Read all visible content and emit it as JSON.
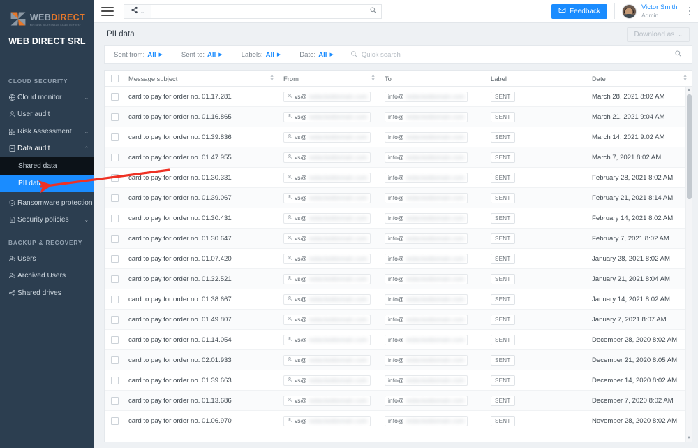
{
  "brand": {
    "logo_word_1": "WEB",
    "logo_word_2": "DIRECT",
    "logo_tagline": "BUSINESS RELATIONSHIP BASED ON TRUST",
    "company": "WEB DIRECT SRL"
  },
  "sidebar": {
    "section_cloud": "CLOUD SECURITY",
    "section_backup": "BACKUP & RECOVERY",
    "cloud_items": [
      {
        "label": "Cloud monitor",
        "icon": "globe-icon",
        "caret": "⌄",
        "has_caret": true
      },
      {
        "label": "User audit",
        "icon": "user-icon",
        "caret": "",
        "has_caret": false
      },
      {
        "label": "Risk Assessment",
        "icon": "grid-icon",
        "caret": "⌄",
        "has_caret": true
      },
      {
        "label": "Data audit",
        "icon": "database-icon",
        "caret": "⌃",
        "has_caret": true
      }
    ],
    "data_audit_children": [
      {
        "label": "Shared data",
        "state": "dark"
      },
      {
        "label": "PII data",
        "state": "active"
      }
    ],
    "cloud_items_after": [
      {
        "label": "Ransomware protection",
        "icon": "shield-icon",
        "caret": "",
        "has_caret": false
      },
      {
        "label": "Security policies",
        "icon": "policy-icon",
        "caret": "⌄",
        "has_caret": true
      }
    ],
    "backup_items": [
      {
        "label": "Users",
        "icon": "users-icon"
      },
      {
        "label": "Archived Users",
        "icon": "users-archive-icon"
      },
      {
        "label": "Shared drives",
        "icon": "share-icon"
      }
    ]
  },
  "topbar": {
    "menu_icon": "hamburger-icon",
    "share_icon": "share-nodes-icon",
    "share_caret": "⌄",
    "search_value": "",
    "search_placeholder": "",
    "search_icon": "search-icon",
    "feedback_label": "Feedback",
    "feedback_icon": "envelope-icon",
    "user_name": "Victor Smith",
    "user_role": "Admin",
    "kebab_icon": "more-vertical-icon"
  },
  "page": {
    "title": "PII data",
    "download_label": "Download as",
    "download_caret": "⌄"
  },
  "filters": [
    {
      "name": "Sent from",
      "label": "Sent from:",
      "value": "All",
      "arrow": "▶"
    },
    {
      "name": "Sent to",
      "label": "Sent to:",
      "value": "All",
      "arrow": "▶"
    },
    {
      "name": "Labels",
      "label": "Labels:",
      "value": "All",
      "arrow": "▶"
    },
    {
      "name": "Date",
      "label": "Date:",
      "value": "All",
      "arrow": "▶"
    }
  ],
  "quick_search": {
    "placeholder": "Quick search",
    "value": "",
    "left_icon": "search-icon",
    "right_icon": "search-icon"
  },
  "table": {
    "columns": [
      {
        "key": "checkbox",
        "label": "",
        "sortable": false
      },
      {
        "key": "subject",
        "label": "Message subject",
        "sortable": true
      },
      {
        "key": "from",
        "label": "From",
        "sortable": true
      },
      {
        "key": "to",
        "label": "To",
        "sortable": false
      },
      {
        "key": "label",
        "label": "Label",
        "sortable": false
      },
      {
        "key": "date",
        "label": "Date",
        "sortable": true
      }
    ],
    "from_prefix": "vs@",
    "to_prefix": "info@",
    "from_redacted": "redacteddomain.com",
    "to_redacted": "redacteddomain.com",
    "label_value": "SENT",
    "rows": [
      {
        "subject": "card to pay for order no. 01.17.281",
        "date": "March 28, 2021 8:02 AM"
      },
      {
        "subject": "card to pay for order no. 01.16.865",
        "date": "March 21, 2021 9:04 AM"
      },
      {
        "subject": "card to pay for order no. 01.39.836",
        "date": "March 14, 2021 9:02 AM"
      },
      {
        "subject": "card to pay for order no. 01.47.955",
        "date": "March 7, 2021 8:02 AM"
      },
      {
        "subject": "card to pay for order no. 01.30.331",
        "date": "February 28, 2021 8:02 AM"
      },
      {
        "subject": "card to pay for order no. 01.39.067",
        "date": "February 21, 2021 8:14 AM"
      },
      {
        "subject": "card to pay for order no. 01.30.431",
        "date": "February 14, 2021 8:02 AM"
      },
      {
        "subject": "card to pay for order no. 01.30.647",
        "date": "February 7, 2021 8:02 AM"
      },
      {
        "subject": "card to pay for order no. 01.07.420",
        "date": "January 28, 2021 8:02 AM"
      },
      {
        "subject": "card to pay for order no. 01.32.521",
        "date": "January 21, 2021 8:04 AM"
      },
      {
        "subject": "card to pay for order no. 01.38.667",
        "date": "January 14, 2021 8:02 AM"
      },
      {
        "subject": "card to pay for order no. 01.49.807",
        "date": "January 7, 2021 8:07 AM"
      },
      {
        "subject": "card to pay for order no. 01.14.054",
        "date": "December 28, 2020 8:02 AM"
      },
      {
        "subject": "card to pay for order no. 02.01.933",
        "date": "December 21, 2020 8:05 AM"
      },
      {
        "subject": "card to pay for order no. 01.39.663",
        "date": "December 14, 2020 8:02 AM"
      },
      {
        "subject": "card to pay for order no. 01.13.686",
        "date": "December 7, 2020 8:02 AM"
      },
      {
        "subject": "card to pay for order no. 01.06.970",
        "date": "November 28, 2020 8:02 AM"
      }
    ]
  },
  "annotation": {
    "type": "arrow",
    "color": "#ee3124",
    "points_to": "PII data"
  },
  "colors": {
    "sidebar_bg": "#2c3e50",
    "accent_blue": "#1a8cff",
    "brand_orange": "#e8782a",
    "annotation_red": "#ee3124",
    "page_bg": "#eef1f4"
  }
}
